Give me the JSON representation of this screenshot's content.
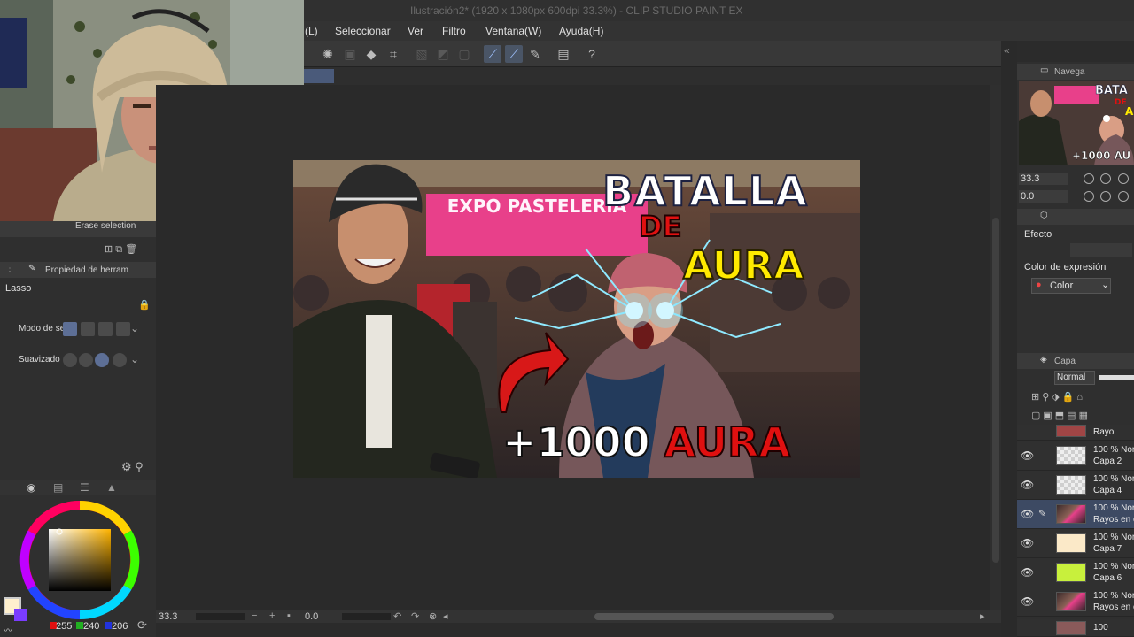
{
  "window": {
    "title": "Ilustración2* (1920 x 1080px 600dpi 33.3%) - CLIP STUDIO PAINT EX"
  },
  "menu": [
    "(L)",
    "Seleccionar",
    "Ver",
    "Filtro",
    "Ventana(W)",
    "Ayuda(H)"
  ],
  "thumbnail": {
    "headline_1": "BATALLA",
    "headline_2": "DE",
    "headline_3": "AURA",
    "banner": "EXPO PASTELERÍA",
    "bottom": "+1000 AURA",
    "colors": {
      "white_text": "#ffffff",
      "red_text": "#e01010",
      "yellow_text": "#ffea00",
      "banner_pink": "#e8408a"
    }
  },
  "left_panel": {
    "sub_tool_label": "Erase selection",
    "tool_property_tab": "Propiedad de herram",
    "tool_name": "Lasso",
    "mode_label": "Modo de se",
    "smoothing_label": "Suavizado"
  },
  "color": {
    "r": "255",
    "g": "240",
    "b": "206",
    "main_swatch": "#fff0ce",
    "sub_swatch": "#7a3cff"
  },
  "status": {
    "zoom": "33.3",
    "rotation": "0.0"
  },
  "navigator": {
    "tab": "Navega",
    "zoom": "33.3",
    "rotation": "0.0"
  },
  "layer_property": {
    "effect_label": "Efecto",
    "expression_label": "Color de expresión",
    "expression_value": "Color"
  },
  "layers": {
    "tab": "Capa",
    "blend_mode": "Normal",
    "items": [
      {
        "l1": "100 % Nor",
        "l2": "Capa 2",
        "thumb": "checker",
        "selected": false
      },
      {
        "l1": "100 % Nor",
        "l2": "Capa 4",
        "thumb": "checker",
        "selected": false
      },
      {
        "l1": "100 % Nor",
        "l2": "Rayos en ojo",
        "thumb": "photo",
        "selected": true
      },
      {
        "l1": "100 % Nor",
        "l2": "Capa 7",
        "thumb": "#fbe9c8",
        "selected": false
      },
      {
        "l1": "100 % Nor",
        "l2": "Capa 6",
        "thumb": "#c8f03c",
        "selected": false
      },
      {
        "l1": "100 % Nor",
        "l2": "Rayos en ojo",
        "thumb": "photo",
        "selected": false
      }
    ],
    "top_partial_label": "Rayo",
    "bottom_partial_label": "100"
  }
}
